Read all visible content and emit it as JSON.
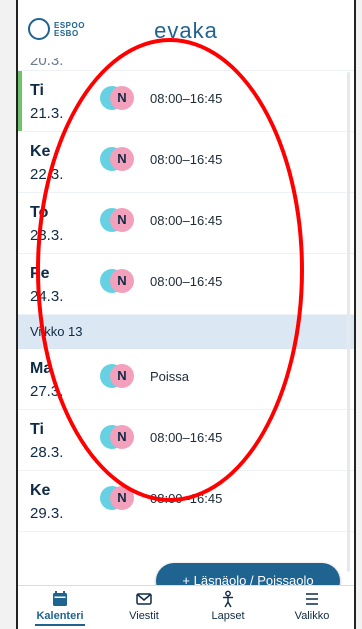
{
  "header": {
    "logo_line1": "ESPOO",
    "logo_line2": "ESBO",
    "brand": "evaka"
  },
  "rows_before": [
    {
      "day": "",
      "date": "20.3.",
      "time": ""
    }
  ],
  "rows": [
    {
      "day": "Ti",
      "date": "21.3.",
      "time": "08:00–16:45",
      "today": true
    },
    {
      "day": "Ke",
      "date": "22.3.",
      "time": "08:00–16:45"
    },
    {
      "day": "To",
      "date": "23.3.",
      "time": "08:00–16:45"
    },
    {
      "day": "Pe",
      "date": "24.3.",
      "time": "08:00–16:45"
    }
  ],
  "week_label": "Viikko 13",
  "rows_after": [
    {
      "day": "Ma",
      "date": "27.3.",
      "time": "Poissa"
    },
    {
      "day": "Ti",
      "date": "28.3.",
      "time": "08:00–16:45"
    },
    {
      "day": "Ke",
      "date": "29.3.",
      "time": "08:00–16:45"
    }
  ],
  "avatar_initial": "N",
  "fab_label": "+ Läsnäolo / Poissaolo",
  "nav": [
    {
      "label": "Kalenteri",
      "icon": "calendar-icon",
      "active": true
    },
    {
      "label": "Viestit",
      "icon": "envelope-icon"
    },
    {
      "label": "Lapset",
      "icon": "child-icon"
    },
    {
      "label": "Valikko",
      "icon": "menu-icon"
    }
  ],
  "colors": {
    "brand": "#1f6390",
    "avatar1": "#66d1e2",
    "avatar2": "#f3a0bd",
    "week_bg": "#dbe7f3",
    "today_bar": "#6fc36a"
  }
}
